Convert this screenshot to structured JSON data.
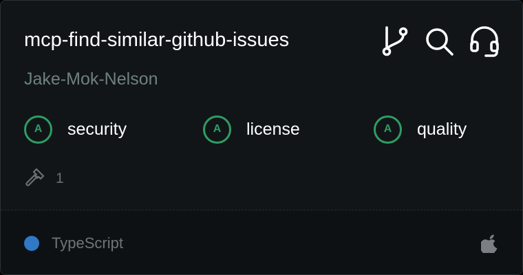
{
  "server": {
    "name": "mcp-find-similar-github-issues",
    "author": "Jake-Mok-Nelson"
  },
  "actions": [
    {
      "icon": "git-branch-icon"
    },
    {
      "icon": "search-icon"
    },
    {
      "icon": "headset-icon"
    }
  ],
  "grades": [
    {
      "letter": "A",
      "label": "security"
    },
    {
      "letter": "A",
      "label": "license"
    },
    {
      "letter": "A",
      "label": "quality"
    }
  ],
  "tools": {
    "icon": "hammer-icon",
    "count": "1"
  },
  "footer": {
    "language": "TypeScript",
    "language_color": "#3178c6",
    "platform_icon": "apple-icon"
  },
  "colors": {
    "grade_green": "#2f9d63",
    "card_background": "#111518",
    "author_text": "#6f817c"
  }
}
